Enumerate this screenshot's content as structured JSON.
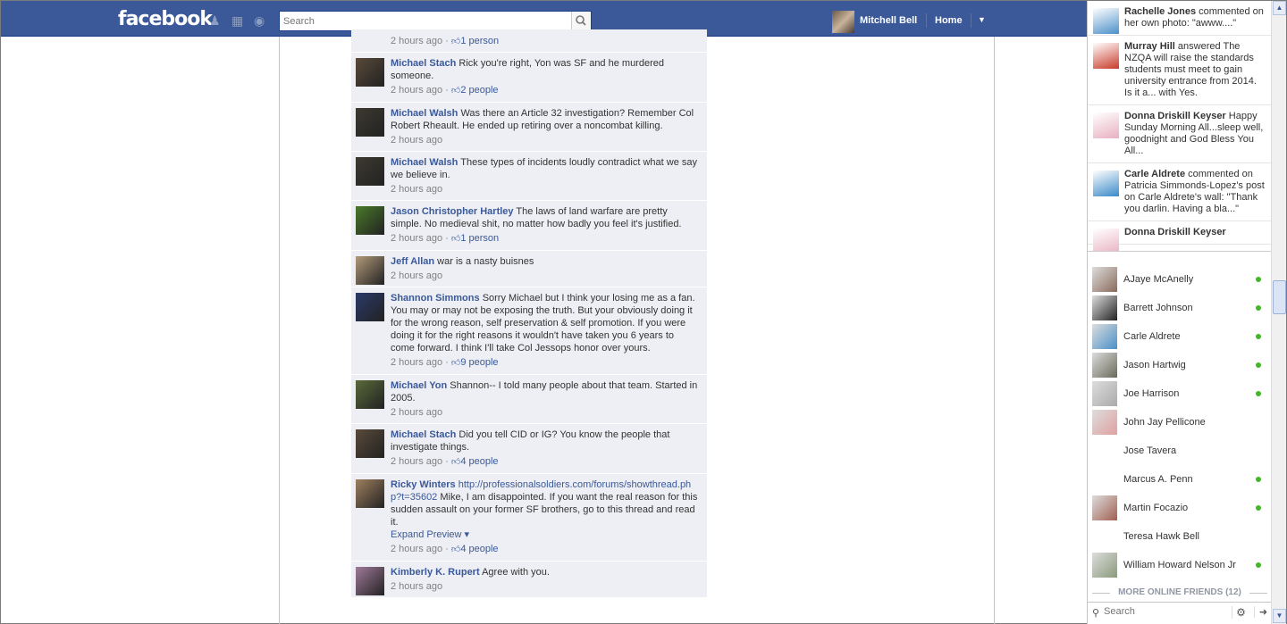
{
  "header": {
    "logo": "facebook",
    "search_placeholder": "Search",
    "user_name": "Mitchell Bell",
    "home_label": "Home",
    "account_arrow": "▼"
  },
  "comments": [
    {
      "author": "",
      "text": "",
      "time": "2 hours ago",
      "likes": "1 person"
    },
    {
      "author": "Michael Stach",
      "text": "Rick you're right, Yon was SF and he murdered someone.",
      "time": "2 hours ago",
      "likes": "2 people"
    },
    {
      "author": "Michael Walsh",
      "text": "Was there an Article 32 investigation? Remember Col Robert Rheault. He ended up retiring over a noncombat killing.",
      "time": "2 hours ago",
      "likes": ""
    },
    {
      "author": "Michael Walsh",
      "text": "These types of incidents loudly contradict what we say we believe in.",
      "time": "2 hours ago",
      "likes": ""
    },
    {
      "author": "Jason Christopher Hartley",
      "text": "The laws of land warfare are pretty simple. No medieval shit, no matter how badly you feel it's justified.",
      "time": "2 hours ago",
      "likes": "1 person"
    },
    {
      "author": "Jeff Allan",
      "text": "war is a nasty buisnes",
      "time": "2 hours ago",
      "likes": ""
    },
    {
      "author": "Shannon Simmons",
      "text": "Sorry Michael but I think your losing me as a fan. You may or may not be exposing the truth. But your obviously doing it for the wrong reason, self preservation & self promotion. If you were doing it for the right reasons it wouldn't have taken you 6 years to come forward. I think I'll take Col Jessops honor over yours.",
      "time": "2 hours ago",
      "likes": "9 people"
    },
    {
      "author": "Michael Yon",
      "text": "Shannon-- I told many people about that team. Started in 2005.",
      "time": "2 hours ago",
      "likes": ""
    },
    {
      "author": "Michael Stach",
      "text": "Did you tell CID or IG? You know the people that investigate things.",
      "time": "2 hours ago",
      "likes": "4 people"
    },
    {
      "author": "Ricky Winters",
      "link": "http://professionalsoldiers.com/forums/showthread.php?t=35602",
      "text": " Mike, I am disappointed. If you want the real reason for this sudden assault on your former SF brothers, go to this thread and read it.",
      "expand": "Expand Preview ▾",
      "time": "2 hours ago",
      "likes": "4 people"
    },
    {
      "author": "Kimberly K. Rupert",
      "text": "Agree with you.",
      "time": "2 hours ago",
      "likes": ""
    }
  ],
  "ticker": [
    {
      "name": "Rachelle Jones",
      "text": " commented on her own photo: \"awww....\""
    },
    {
      "name": "Murray Hill",
      "text": " answered The NZQA will raise the standards students must meet to gain university entrance from 2014. Is it a... with Yes."
    },
    {
      "name": "Donna Driskill Keyser",
      "text": " Happy Sunday Morning All...sleep well, goodnight and God Bless You All..."
    },
    {
      "name": "Carle Aldrete",
      "text": " commented on Patricia Simmonds-Lopez's post on Carle Aldrete's wall: \"Thank you darlin. Having a bla...\""
    },
    {
      "name": "Donna Driskill Keyser",
      "text": ""
    }
  ],
  "friends": [
    {
      "name": "AJaye McAnelly",
      "online": true
    },
    {
      "name": "Barrett Johnson",
      "online": true
    },
    {
      "name": "Carle Aldrete",
      "online": true
    },
    {
      "name": "Jason Hartwig",
      "online": true
    },
    {
      "name": "Joe Harrison",
      "online": true
    },
    {
      "name": "John Jay Pellicone",
      "online": false
    },
    {
      "name": "Jose Tavera",
      "online": false
    },
    {
      "name": "Marcus A. Penn",
      "online": true
    },
    {
      "name": "Martin Focazio",
      "online": true
    },
    {
      "name": "Teresa Hawk Bell",
      "online": false
    },
    {
      "name": "William Howard Nelson Jr",
      "online": true
    }
  ],
  "chat": {
    "more_online": "MORE ONLINE FRIENDS (12)",
    "search_placeholder": "Search"
  },
  "colors": {
    "brand": "#3b5998",
    "comment_bg": "#edeff4",
    "online": "#42b72a"
  }
}
